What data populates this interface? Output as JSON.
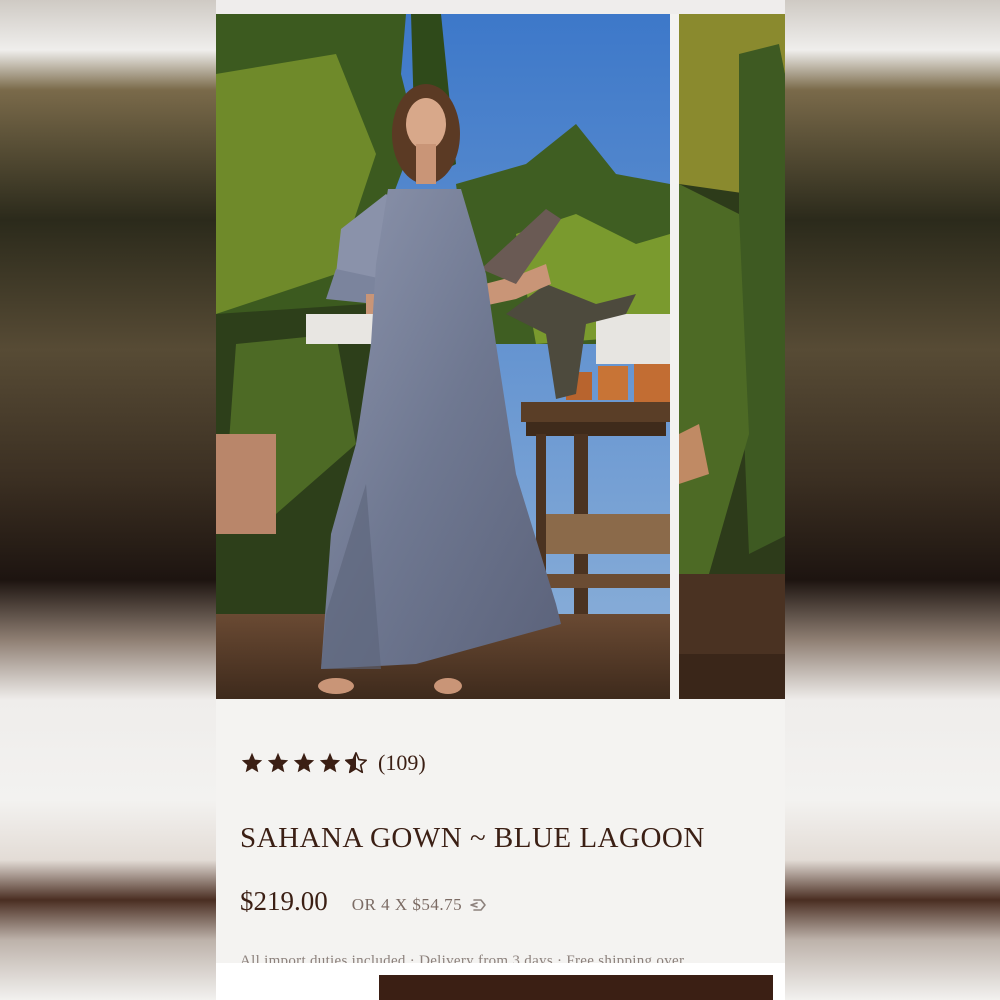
{
  "product": {
    "rating": {
      "value": 4.5,
      "max": 5,
      "count_label": "(109)"
    },
    "title": "SAHANA GOWN ~ BLUE LAGOON",
    "price": "$219.00",
    "installments": "OR 4 X $54.75",
    "shipping_note": "All import duties included · Delivery from 3 days · Free shipping over"
  },
  "icons": {
    "star": "star-icon",
    "half_star": "half-star-icon",
    "afterpay": "afterpay-icon"
  },
  "colors": {
    "brand_dark": "#3b1f14",
    "muted_text": "#7b6b64",
    "page_bg": "#f4f3f1"
  }
}
